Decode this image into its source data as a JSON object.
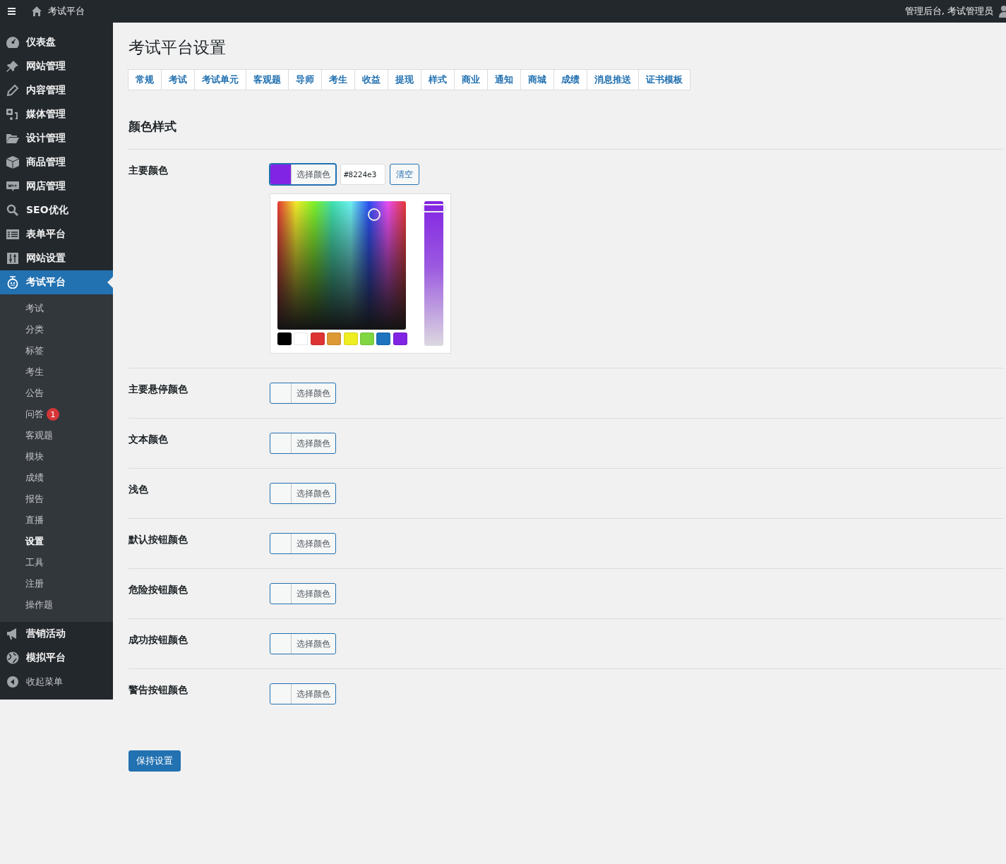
{
  "topbar": {
    "site_title": "考试平台",
    "greeting": "管理后台, 考试管理员"
  },
  "sidebar": {
    "items": [
      {
        "label": "仪表盘",
        "selected": false
      },
      {
        "label": "网站管理",
        "selected": false
      },
      {
        "label": "内容管理",
        "selected": false
      },
      {
        "label": "媒体管理",
        "selected": false
      },
      {
        "label": "设计管理",
        "selected": false
      },
      {
        "label": "商品管理",
        "selected": false
      },
      {
        "label": "网店管理",
        "selected": false
      },
      {
        "label": "SEO优化",
        "selected": false
      },
      {
        "label": "表单平台",
        "selected": false
      },
      {
        "label": "网站设置",
        "selected": false
      },
      {
        "label": "考试平台",
        "selected": true,
        "children": [
          {
            "label": "考试",
            "selected": false
          },
          {
            "label": "分类",
            "selected": false
          },
          {
            "label": "标签",
            "selected": false
          },
          {
            "label": "考生",
            "selected": false
          },
          {
            "label": "公告",
            "selected": false
          },
          {
            "label": "问答",
            "selected": false,
            "badge": "1"
          },
          {
            "label": "客观题",
            "selected": false
          },
          {
            "label": "模块",
            "selected": false
          },
          {
            "label": "成绩",
            "selected": false
          },
          {
            "label": "报告",
            "selected": false
          },
          {
            "label": "直播",
            "selected": false
          },
          {
            "label": "设置",
            "selected": true
          },
          {
            "label": "工具",
            "selected": false
          },
          {
            "label": "注册",
            "selected": false
          },
          {
            "label": "操作题",
            "selected": false
          }
        ]
      },
      {
        "label": "营销活动",
        "selected": false
      },
      {
        "label": "模拟平台",
        "selected": false
      }
    ],
    "collapse_label": "收起菜单"
  },
  "page_title": "考试平台设置",
  "tabs": [
    {
      "label": "常规",
      "selected": false
    },
    {
      "label": "考试",
      "selected": false
    },
    {
      "label": "考试单元",
      "selected": false
    },
    {
      "label": "客观题",
      "selected": false
    },
    {
      "label": "导师",
      "selected": false
    },
    {
      "label": "考生",
      "selected": false
    },
    {
      "label": "收益",
      "selected": false
    },
    {
      "label": "提现",
      "selected": false
    },
    {
      "label": "样式",
      "selected": false
    },
    {
      "label": "商业",
      "selected": false
    },
    {
      "label": "通知",
      "selected": false
    },
    {
      "label": "商城",
      "selected": false
    },
    {
      "label": "成绩",
      "selected": false
    },
    {
      "label": "消息推送",
      "selected": false
    },
    {
      "label": "证书模板",
      "selected": false
    }
  ],
  "section_title": "颜色样式",
  "color_settings": [
    {
      "label": "主要颜色",
      "button_label": "选择颜色",
      "expanded": true,
      "color": "#8224e3",
      "value": "#8224e3",
      "clear_label": "清空"
    },
    {
      "label": "主要悬停颜色",
      "button_label": "选择颜色",
      "expanded": false
    },
    {
      "label": "文本颜色",
      "button_label": "选择颜色",
      "expanded": false
    },
    {
      "label": "浅色",
      "button_label": "选择颜色",
      "expanded": false
    },
    {
      "label": "默认按钮颜色",
      "button_label": "选择颜色",
      "expanded": false
    },
    {
      "label": "危险按钮颜色",
      "button_label": "选择颜色",
      "expanded": false
    },
    {
      "label": "成功按钮颜色",
      "button_label": "选择颜色",
      "expanded": false
    },
    {
      "label": "警告按钮颜色",
      "button_label": "选择颜色",
      "expanded": false
    }
  ],
  "picker": {
    "level": 0.95,
    "swatches": [
      {
        "color": "#000000"
      },
      {
        "color": "#ffffff"
      },
      {
        "color": "#dd3333"
      },
      {
        "color": "#dd9933"
      },
      {
        "color": "#eeee22"
      },
      {
        "color": "#81d742"
      },
      {
        "color": "#1e73be"
      },
      {
        "color": "#8224e3"
      }
    ]
  },
  "save_button": "保持设置"
}
